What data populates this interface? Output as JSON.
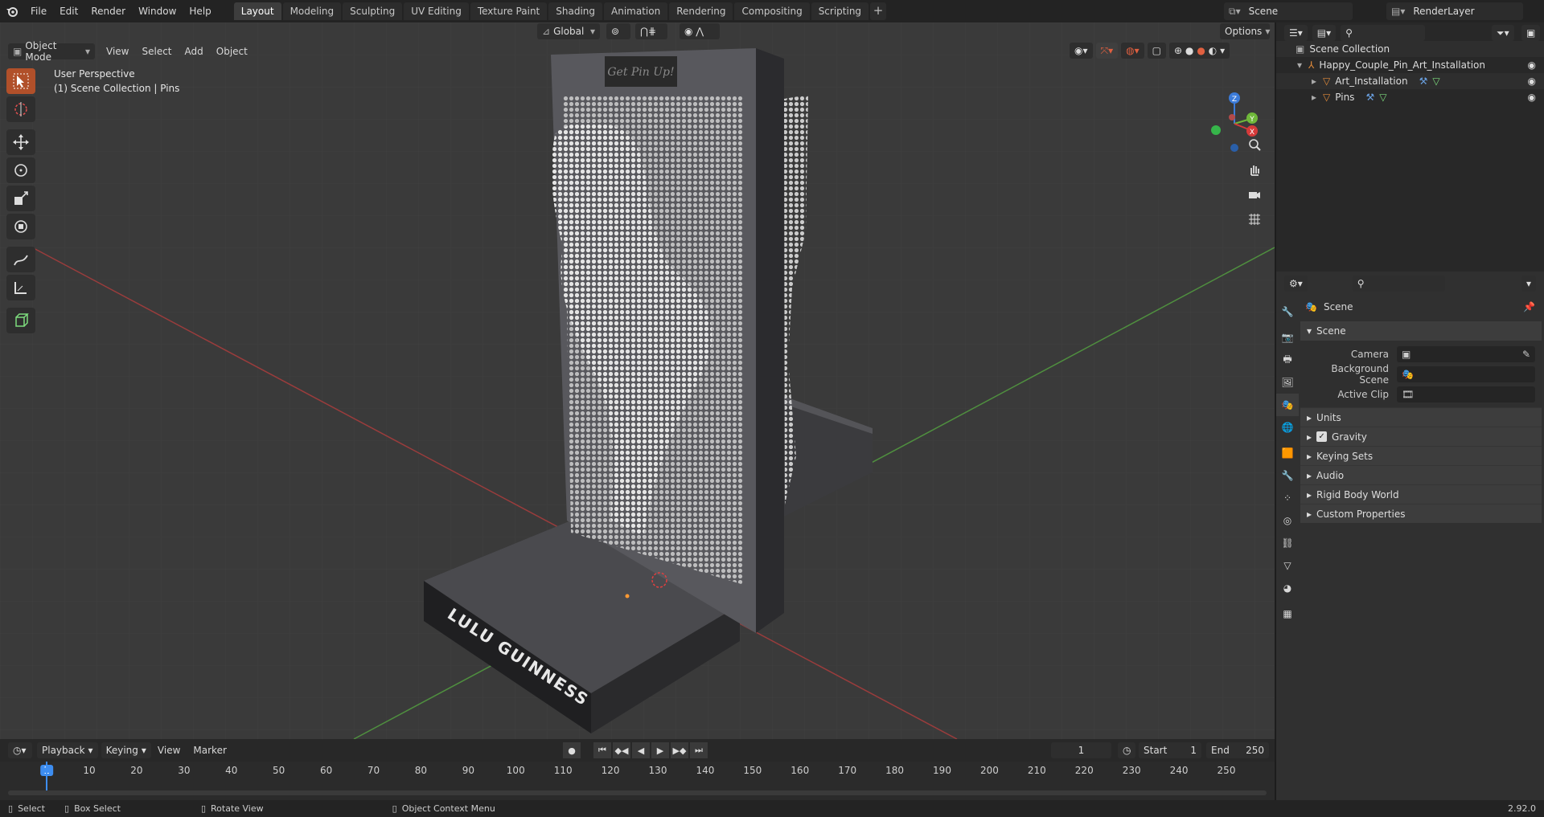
{
  "app": {
    "logo": "blender-logo-icon"
  },
  "menus": [
    "File",
    "Edit",
    "Render",
    "Window",
    "Help"
  ],
  "workspaces": [
    "Layout",
    "Modeling",
    "Sculpting",
    "UV Editing",
    "Texture Paint",
    "Shading",
    "Animation",
    "Rendering",
    "Compositing",
    "Scripting"
  ],
  "active_workspace": "Layout",
  "scene_selector": {
    "label": "Scene"
  },
  "layer_selector": {
    "label": "RenderLayer"
  },
  "viewport_header": {
    "mode": "Object Mode",
    "menus": [
      "View",
      "Select",
      "Add",
      "Object"
    ],
    "transform_orientation": "Global",
    "options_label": "Options"
  },
  "viewport": {
    "perspective": "User Perspective",
    "collection_info": "(1) Scene Collection | Pins",
    "base_text": "LULU GUINNESS",
    "plaque_text": "Get Pin Up!"
  },
  "tools": [
    "select-box-icon",
    "cursor-icon",
    "move-icon",
    "rotate-icon",
    "scale-icon",
    "transform-icon",
    "annotate-icon",
    "measure-icon",
    "add-cube-icon"
  ],
  "outliner": {
    "search_placeholder": "",
    "root": "Scene Collection",
    "collection": "Happy_Couple_Pin_Art_Installation",
    "items": [
      {
        "name": "Art_Installation"
      },
      {
        "name": "Pins"
      }
    ]
  },
  "properties": {
    "header": "Scene",
    "panel_title": "Scene",
    "fields": [
      {
        "label": "Camera",
        "value": ""
      },
      {
        "label": "Background Scene",
        "value": ""
      },
      {
        "label": "Active Clip",
        "value": ""
      }
    ],
    "sections": [
      "Units",
      "Gravity",
      "Keying Sets",
      "Audio",
      "Rigid Body World",
      "Custom Properties"
    ],
    "gravity_checked": true
  },
  "timeline": {
    "menus": [
      "Playback",
      "Keying",
      "View",
      "Marker"
    ],
    "current_frame": "1",
    "start_label": "Start",
    "start": "1",
    "end_label": "End",
    "end": "250",
    "ticks": [
      "1",
      "10",
      "20",
      "30",
      "40",
      "50",
      "60",
      "70",
      "80",
      "90",
      "100",
      "110",
      "120",
      "130",
      "140",
      "150",
      "160",
      "170",
      "180",
      "190",
      "200",
      "210",
      "220",
      "230",
      "240",
      "250"
    ]
  },
  "status": {
    "select": "Select",
    "box_select": "Box Select",
    "rotate": "Rotate View",
    "context": "Object Context Menu",
    "version": "2.92.0"
  }
}
